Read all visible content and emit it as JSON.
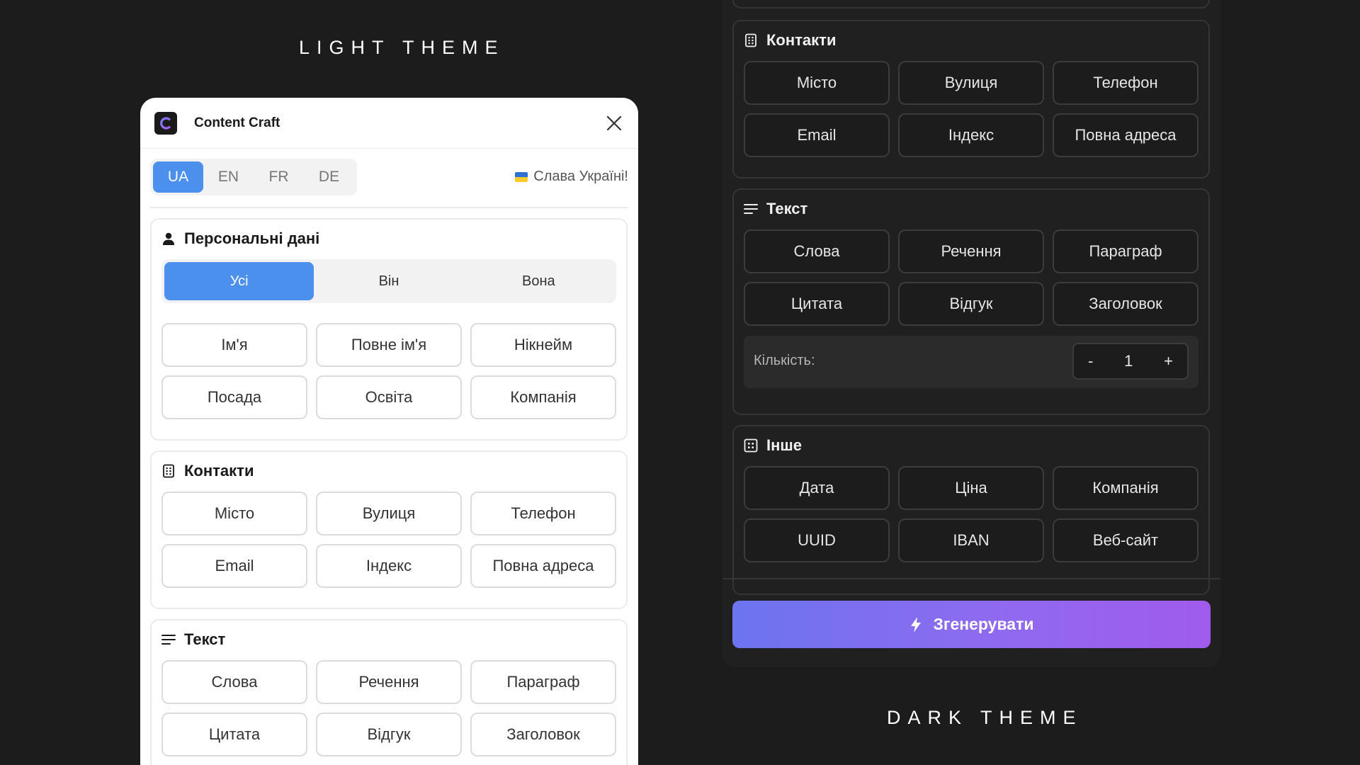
{
  "captions": {
    "light": "LIGHT THEME",
    "dark": "DARK THEME"
  },
  "app": {
    "title": "Content Craft"
  },
  "languages": [
    "UA",
    "EN",
    "FR",
    "DE"
  ],
  "active_language": "UA",
  "slogan": "Слава Україні!",
  "personal": {
    "title": "Персональні дані",
    "gender": [
      "Усі",
      "Він",
      "Вона"
    ],
    "items": [
      "Ім'я",
      "Повне ім'я",
      "Нікнейм",
      "Посада",
      "Освіта",
      "Компанія"
    ]
  },
  "contacts": {
    "title": "Контакти",
    "items": [
      "Місто",
      "Вулиця",
      "Телефон",
      "Email",
      "Індекс",
      "Повна адреса"
    ]
  },
  "text": {
    "title": "Текст",
    "items": [
      "Слова",
      "Речення",
      "Параграф",
      "Цитата",
      "Відгук",
      "Заголовок"
    ],
    "quantity_label": "Кількість:",
    "quantity_value": "1",
    "minus": "-",
    "plus": "+"
  },
  "other": {
    "title": "Інше",
    "items": [
      "Дата",
      "Ціна",
      "Компанія",
      "UUID",
      "IBAN",
      "Веб-сайт"
    ]
  },
  "generate_label": "Згенерувати",
  "colors": {
    "accent_blue": "#4a90ec",
    "gradient_start": "#6c74ef",
    "gradient_end": "#a15bec"
  }
}
